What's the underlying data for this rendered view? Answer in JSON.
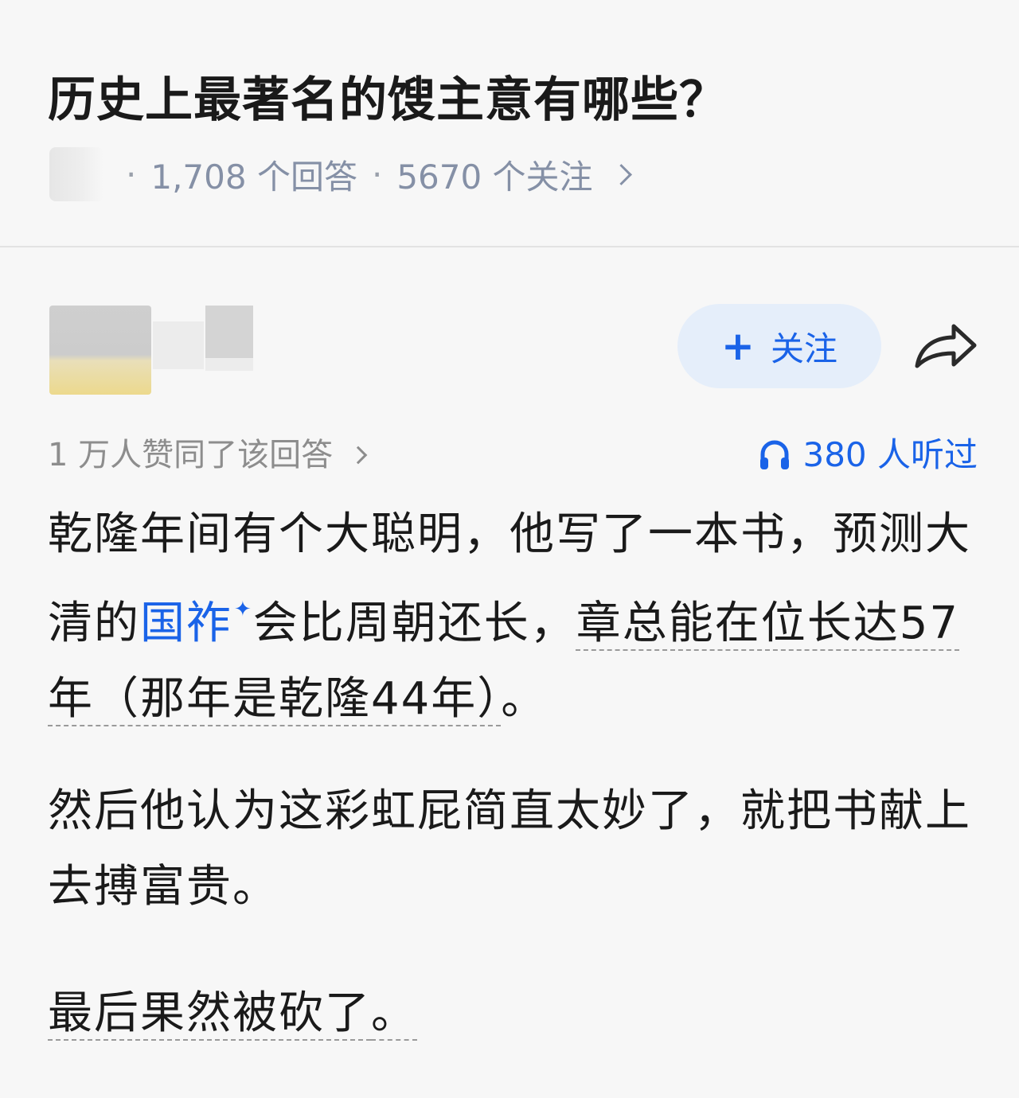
{
  "question": {
    "title": "历史上最著名的馊主意有哪些？",
    "answers_count": "1,708 个回答",
    "followers_count": "5670 个关注",
    "separator": "·"
  },
  "author": {
    "follow_label": "关注",
    "follow_plus": "+"
  },
  "stats": {
    "approve_text": "1 万人赞同了该回答",
    "listen_text": "380 人听过"
  },
  "answer": {
    "p1_a": "乾隆年间有个大聪明，他写了一本书，预测大清的",
    "p1_link": "国祚",
    "p1_spark": "✦",
    "p1_b": "会比周朝还长，",
    "p1_c": "章总能在位长达57年（那年是乾隆44年）",
    "p1_d": "。",
    "p2": "然后他认为这彩虹屁简直太妙了，就把书献上去搏富贵。",
    "p3_a": "最后果然被砍了",
    "p3_b": "。"
  },
  "colors": {
    "accent": "#1a63e8",
    "meta": "#8590a6",
    "muted": "#8d8d8d",
    "follow_bg": "#e5eefa",
    "background": "#f7f7f7"
  },
  "icons": {
    "share": "share-arrow-icon",
    "listen": "headphone-icon",
    "chevron": "chevron-right-icon"
  }
}
